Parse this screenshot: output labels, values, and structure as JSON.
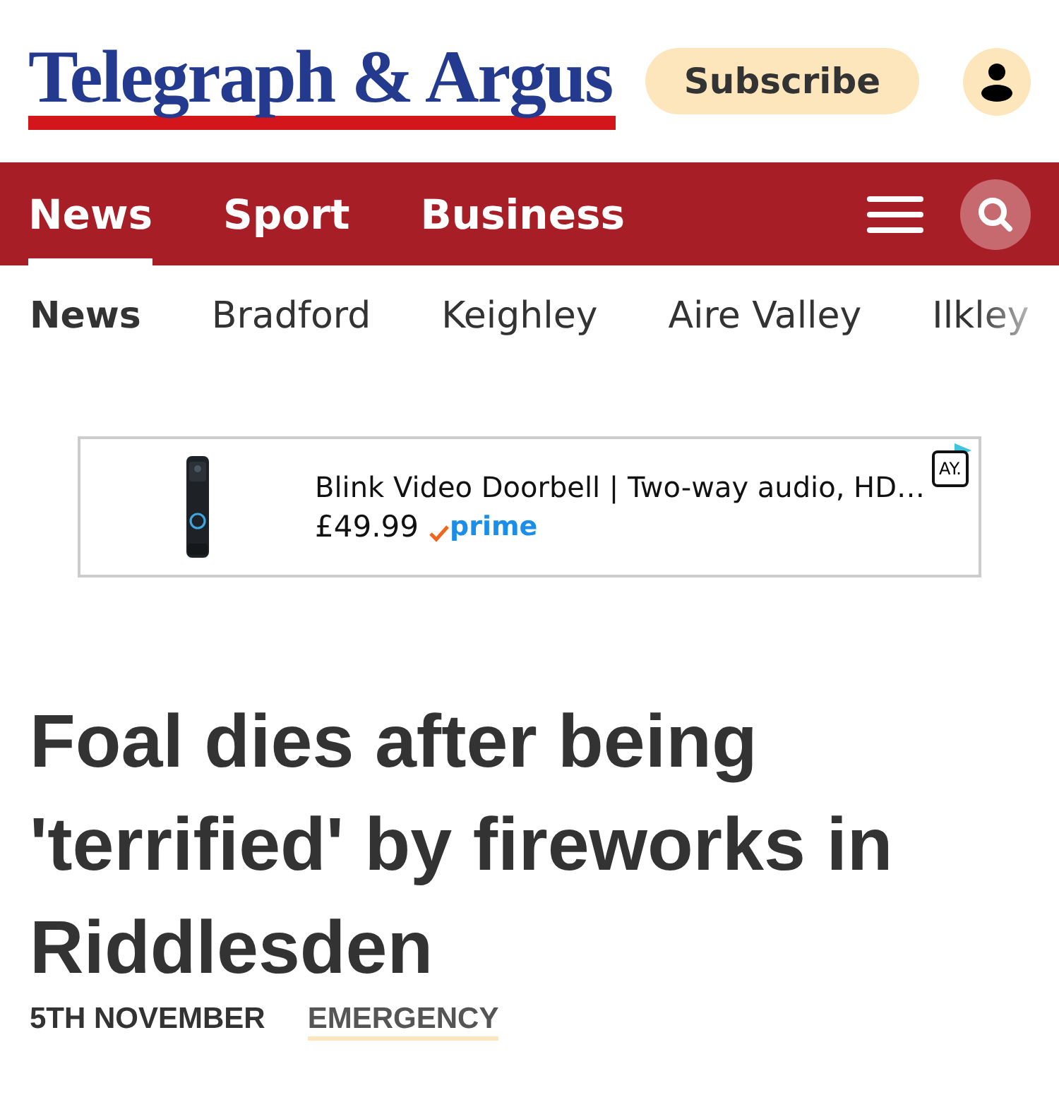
{
  "masthead": {
    "logo": "Telegraph & Argus",
    "subscribe": "Subscribe"
  },
  "main_nav": [
    {
      "label": "News",
      "selected": true
    },
    {
      "label": "Sport",
      "selected": false
    },
    {
      "label": "Business",
      "selected": false
    }
  ],
  "sub_nav": [
    {
      "label": "News",
      "selected": true
    },
    {
      "label": "Bradford",
      "selected": false
    },
    {
      "label": "Keighley",
      "selected": false
    },
    {
      "label": "Aire Valley",
      "selected": false
    },
    {
      "label": "Ilkley",
      "selected": false
    }
  ],
  "ad": {
    "kind": "picture",
    "title": "Blink Video Doorbell | Two-way audio, HD…",
    "price": "£49.99",
    "badge": "prime",
    "choice": "AY."
  },
  "article": {
    "headline": "Foal dies after being 'terrified' by fireworks in Riddlesden",
    "date": "5TH NOVEMBER",
    "category": "EMERGENCY"
  }
}
